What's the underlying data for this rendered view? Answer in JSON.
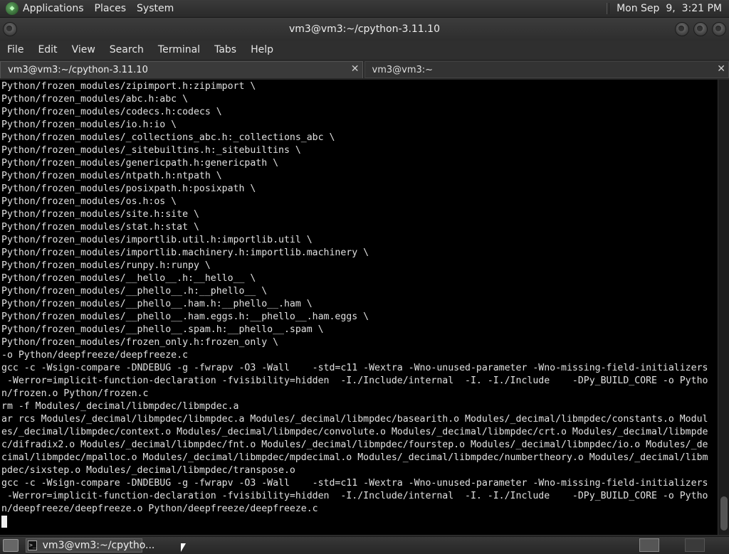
{
  "top_panel": {
    "menus": [
      "Applications",
      "Places",
      "System"
    ],
    "clock": "Mon Sep  9,  3:21 PM"
  },
  "window": {
    "title": "vm3@vm3:~/cpython-3.11.10"
  },
  "menubar": [
    "File",
    "Edit",
    "View",
    "Search",
    "Terminal",
    "Tabs",
    "Help"
  ],
  "tabs": [
    {
      "label": "vm3@vm3:~/cpython-3.11.10",
      "active": true
    },
    {
      "label": "vm3@vm3:~",
      "active": false
    }
  ],
  "terminal": {
    "lines": [
      "Python/frozen_modules/zipimport.h:zipimport \\",
      "Python/frozen_modules/abc.h:abc \\",
      "Python/frozen_modules/codecs.h:codecs \\",
      "Python/frozen_modules/io.h:io \\",
      "Python/frozen_modules/_collections_abc.h:_collections_abc \\",
      "Python/frozen_modules/_sitebuiltins.h:_sitebuiltins \\",
      "Python/frozen_modules/genericpath.h:genericpath \\",
      "Python/frozen_modules/ntpath.h:ntpath \\",
      "Python/frozen_modules/posixpath.h:posixpath \\",
      "Python/frozen_modules/os.h:os \\",
      "Python/frozen_modules/site.h:site \\",
      "Python/frozen_modules/stat.h:stat \\",
      "Python/frozen_modules/importlib.util.h:importlib.util \\",
      "Python/frozen_modules/importlib.machinery.h:importlib.machinery \\",
      "Python/frozen_modules/runpy.h:runpy \\",
      "Python/frozen_modules/__hello__.h:__hello__ \\",
      "Python/frozen_modules/__phello__.h:__phello__ \\",
      "Python/frozen_modules/__phello__.ham.h:__phello__.ham \\",
      "Python/frozen_modules/__phello__.ham.eggs.h:__phello__.ham.eggs \\",
      "Python/frozen_modules/__phello__.spam.h:__phello__.spam \\",
      "Python/frozen_modules/frozen_only.h:frozen_only \\",
      "-o Python/deepfreeze/deepfreeze.c",
      "gcc -c -Wsign-compare -DNDEBUG -g -fwrapv -O3 -Wall    -std=c11 -Wextra -Wno-unused-parameter -Wno-missing-field-initializers",
      " -Werror=implicit-function-declaration -fvisibility=hidden  -I./Include/internal  -I. -I./Include    -DPy_BUILD_CORE -o Pytho",
      "n/frozen.o Python/frozen.c",
      "rm -f Modules/_decimal/libmpdec/libmpdec.a",
      "ar rcs Modules/_decimal/libmpdec/libmpdec.a Modules/_decimal/libmpdec/basearith.o Modules/_decimal/libmpdec/constants.o Modul",
      "es/_decimal/libmpdec/context.o Modules/_decimal/libmpdec/convolute.o Modules/_decimal/libmpdec/crt.o Modules/_decimal/libmpde",
      "c/difradix2.o Modules/_decimal/libmpdec/fnt.o Modules/_decimal/libmpdec/fourstep.o Modules/_decimal/libmpdec/io.o Modules/_de",
      "cimal/libmpdec/mpalloc.o Modules/_decimal/libmpdec/mpdecimal.o Modules/_decimal/libmpdec/numbertheory.o Modules/_decimal/libm",
      "pdec/sixstep.o Modules/_decimal/libmpdec/transpose.o",
      "gcc -c -Wsign-compare -DNDEBUG -g -fwrapv -O3 -Wall    -std=c11 -Wextra -Wno-unused-parameter -Wno-missing-field-initializers",
      " -Werror=implicit-function-declaration -fvisibility=hidden  -I./Include/internal  -I. -I./Include    -DPy_BUILD_CORE -o Pytho",
      "n/deepfreeze/deepfreeze.o Python/deepfreeze/deepfreeze.c"
    ]
  },
  "taskbar": {
    "window_button": "vm3@vm3:~/cpytho...",
    "terminal_icon_glyph": ">_"
  }
}
